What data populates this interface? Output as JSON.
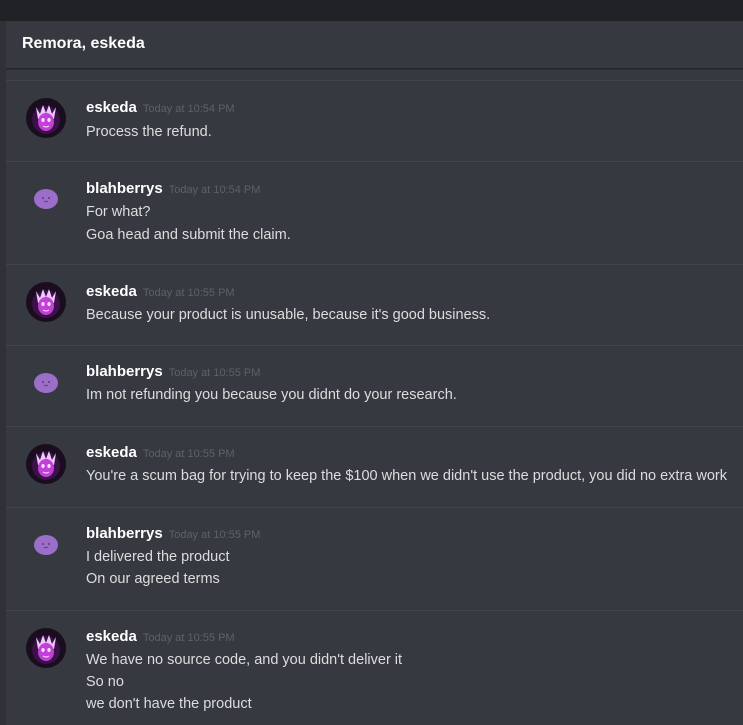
{
  "header": {
    "title": "Remora, eskeda"
  },
  "messages": [
    {
      "author": "eskeda",
      "time": "Today at 10:54 PM",
      "avatar": "eskeda-avatar",
      "lines": [
        "Process the refund."
      ]
    },
    {
      "author": "blahberrys",
      "time": "Today at 10:54 PM",
      "avatar": "blahberrys-avatar",
      "lines": [
        "For what?",
        "Goa head and submit the claim."
      ]
    },
    {
      "author": "eskeda",
      "time": "Today at 10:55 PM",
      "avatar": "eskeda-avatar",
      "lines": [
        "Because your product is unusable, because it's good business."
      ]
    },
    {
      "author": "blahberrys",
      "time": "Today at 10:55 PM",
      "avatar": "blahberrys-avatar",
      "lines": [
        "Im not refunding you because you didnt do your research."
      ]
    },
    {
      "author": "eskeda",
      "time": "Today at 10:55 PM",
      "avatar": "eskeda-avatar",
      "lines": [
        "You're a scum bag for trying to keep the $100 when we didn't use the product, you did no extra work"
      ]
    },
    {
      "author": "blahberrys",
      "time": "Today at 10:55 PM",
      "avatar": "blahberrys-avatar",
      "lines": [
        "I delivered the product",
        "On our agreed terms"
      ]
    },
    {
      "author": "eskeda",
      "time": "Today at 10:55 PM",
      "avatar": "eskeda-avatar",
      "lines": [
        "We have no source code, and you didn't deliver it",
        "So no",
        "we don't have the product"
      ]
    }
  ],
  "colors": {
    "background": "#36393f",
    "topbar": "#202225",
    "username": "#ffffff",
    "timestamp": "#5e6166",
    "message_text": "#dcddde",
    "divider": "#42454a",
    "eskeda_avatar_accent": "#c23fd8",
    "blahberrys_avatar": "#9b6ec9"
  }
}
